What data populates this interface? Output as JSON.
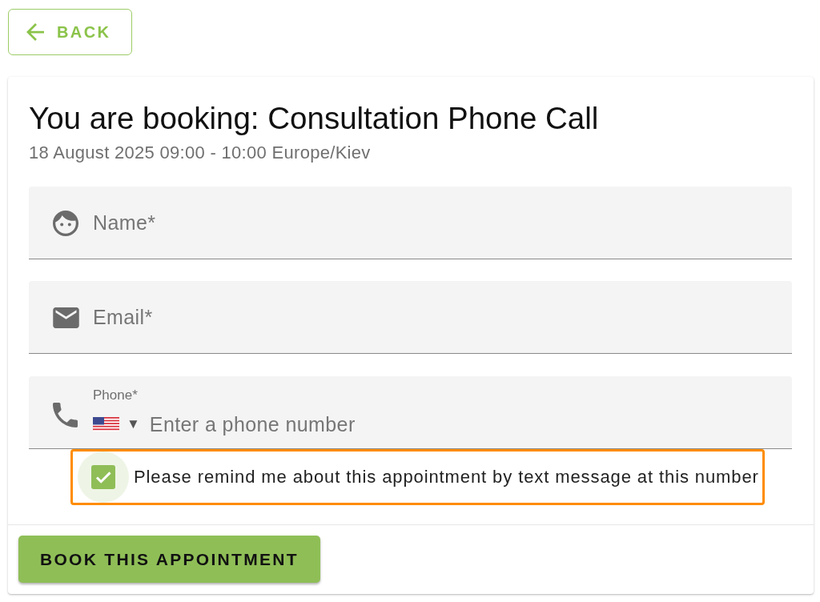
{
  "back_button": {
    "label": "BACK"
  },
  "booking": {
    "title": "You are booking: Consultation Phone Call",
    "when": "18 August 2025 09:00 - 10:00 Europe/Kiev"
  },
  "fields": [
    {
      "kind": "name",
      "placeholder": "Name*"
    },
    {
      "kind": "email",
      "placeholder": "Email*"
    },
    {
      "kind": "phone",
      "label": "Phone*",
      "country_caret": "▼",
      "placeholder": "Enter a phone number"
    }
  ],
  "reminder": {
    "label": "Please remind me about this appointment by text message at this number",
    "checked": true,
    "highlighted": true
  },
  "submit_button": {
    "label": "BOOK THIS APPOINTMENT"
  }
}
